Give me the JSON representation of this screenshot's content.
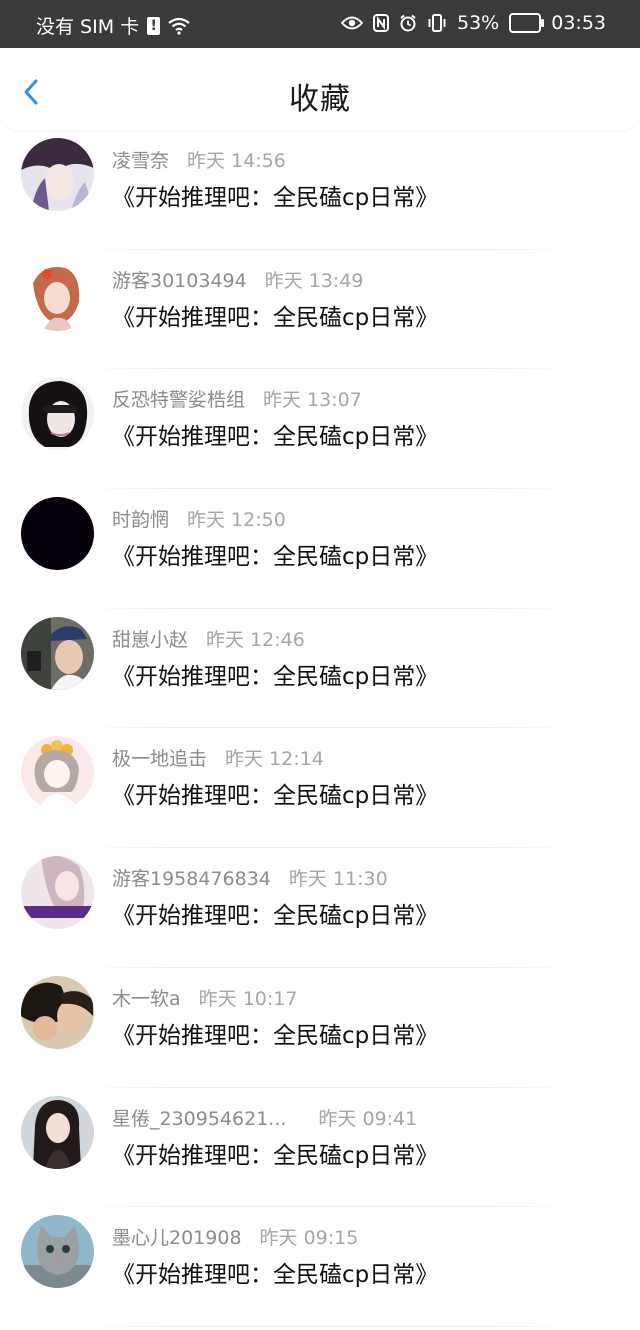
{
  "status_bar": {
    "carrier": "没有 SIM 卡",
    "sim_alert": "!",
    "battery": "53%",
    "time": "03:53"
  },
  "header": {
    "title": "收藏"
  },
  "items": [
    {
      "name": "凌雪奈",
      "time": "昨天 14:56",
      "content": "《开始推理吧：全民磕cp日常》"
    },
    {
      "name": "游客30103494",
      "time": "昨天 13:49",
      "content": "《开始推理吧：全民磕cp日常》"
    },
    {
      "name": "反恐特警娑梏组",
      "time": "昨天 13:07",
      "content": "《开始推理吧：全民磕cp日常》"
    },
    {
      "name": "时韵惘",
      "time": "昨天 12:50",
      "content": "《开始推理吧：全民磕cp日常》"
    },
    {
      "name": "甜崽小赵",
      "time": "昨天 12:46",
      "content": "《开始推理吧：全民磕cp日常》"
    },
    {
      "name": "极一地追击",
      "time": "昨天 12:14",
      "content": "《开始推理吧：全民磕cp日常》"
    },
    {
      "name": "游客1958476834",
      "time": "昨天 11:30",
      "content": "《开始推理吧：全民磕cp日常》"
    },
    {
      "name": "木一软a",
      "time": "昨天 10:17",
      "content": "《开始推理吧：全民磕cp日常》"
    },
    {
      "name": "星倦_230954621...",
      "time": "昨天 09:41",
      "content": "《开始推理吧：全民磕cp日常》"
    },
    {
      "name": "墨心儿201908",
      "time": "昨天 09:15",
      "content": "《开始推理吧：全民磕cp日常》"
    }
  ],
  "colors": {
    "accent": "#2f8fe6",
    "status_bar_bg": "#3a3a3a"
  }
}
